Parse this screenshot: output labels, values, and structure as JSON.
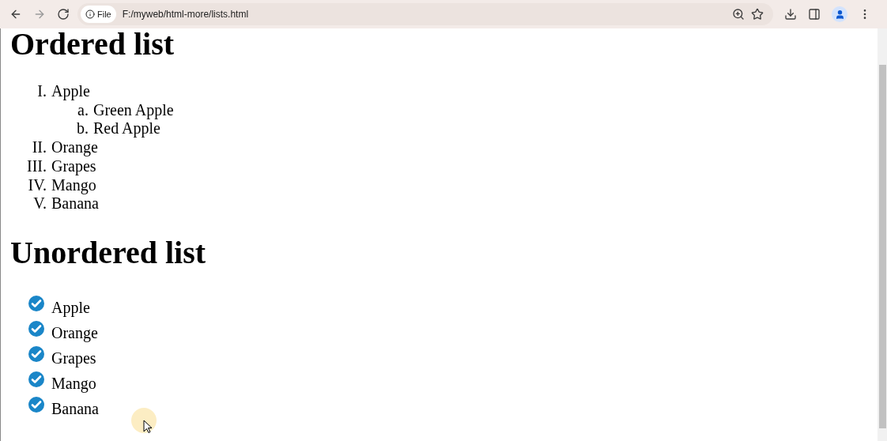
{
  "toolbar": {
    "site_badge": "File",
    "url": "F:/myweb/html-more/lists.html"
  },
  "sections": [
    {
      "heading": "Ordered list",
      "kind": "ordered",
      "items": [
        {
          "marker": "I.",
          "text": "Apple",
          "children": [
            {
              "marker": "a.",
              "text": "Green Apple"
            },
            {
              "marker": "b.",
              "text": "Red Apple"
            }
          ]
        },
        {
          "marker": "II.",
          "text": "Orange"
        },
        {
          "marker": "III.",
          "text": "Grapes"
        },
        {
          "marker": "IV.",
          "text": "Mango"
        },
        {
          "marker": "V.",
          "text": "Banana"
        }
      ]
    },
    {
      "heading": "Unordered list",
      "kind": "checked",
      "items": [
        {
          "text": "Apple"
        },
        {
          "text": "Orange"
        },
        {
          "text": "Grapes"
        },
        {
          "text": "Mango"
        },
        {
          "text": "Banana"
        }
      ]
    }
  ]
}
